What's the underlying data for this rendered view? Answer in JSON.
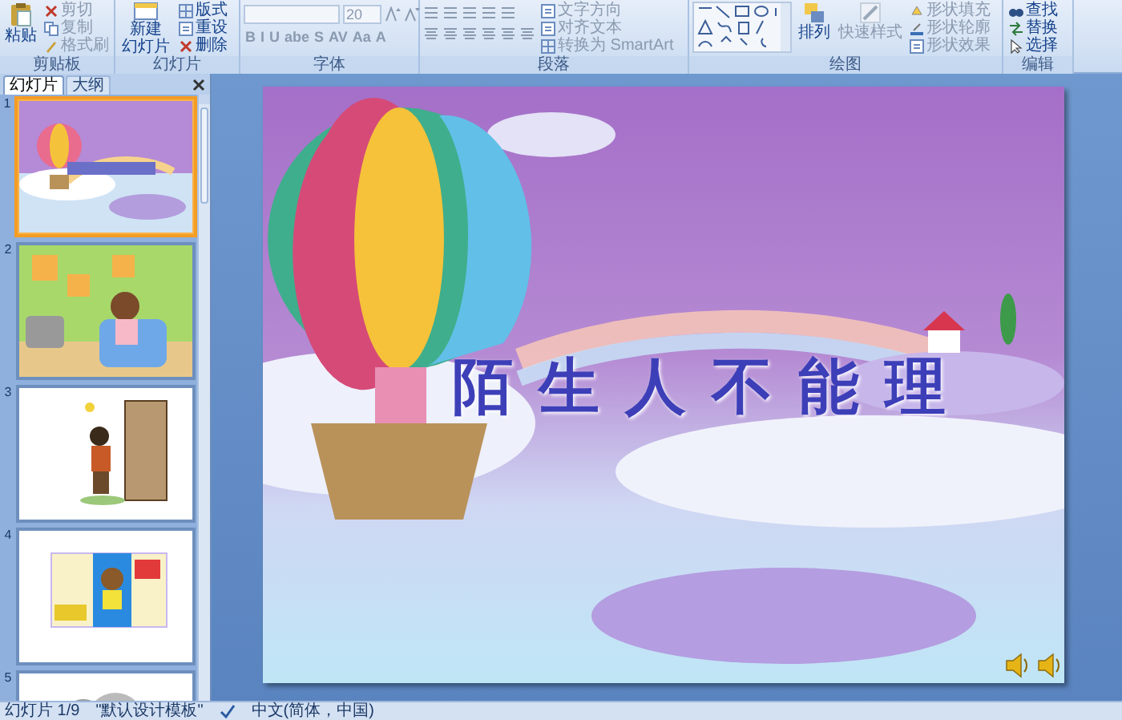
{
  "ribbon": {
    "clipboard": {
      "paste": "粘贴",
      "cut": "剪切",
      "copy": "复制",
      "format_painter": "格式刷",
      "label": "剪贴板"
    },
    "slides": {
      "new_slide": [
        "新建",
        "幻灯片"
      ],
      "layout": "版式",
      "reset": "重设",
      "delete": "删除",
      "label": "幻灯片"
    },
    "font": {
      "size": "20",
      "format_buttons": [
        "B",
        "I",
        "U",
        "abe",
        "S",
        "AV",
        "Aa",
        "A"
      ],
      "label": "字体"
    },
    "paragraph": {
      "text_direction": "文字方向",
      "align_text": "对齐文本",
      "smartart": "转换为 SmartArt",
      "label": "段落"
    },
    "drawing": {
      "arrange": "排列",
      "quick_styles": "快速样式",
      "shape_fill": "形状填充",
      "shape_outline": "形状轮廓",
      "shape_effects": "形状效果",
      "label": "绘图"
    },
    "editing": {
      "find": "查找",
      "replace": "替换",
      "select": "选择",
      "label": "编辑"
    }
  },
  "panel": {
    "tabs": [
      {
        "label": "幻灯片",
        "selected": true
      },
      {
        "label": "大纲",
        "selected": false
      }
    ],
    "thumbnails": [
      {
        "number": "1",
        "selected": true
      },
      {
        "number": "2",
        "selected": false
      },
      {
        "number": "3",
        "selected": false
      },
      {
        "number": "4",
        "selected": false
      },
      {
        "number": "5",
        "selected": false
      }
    ]
  },
  "slide": {
    "title": "陌生人不能理"
  },
  "status_bar": {
    "slide": "幻灯片 1/9",
    "theme": "\"默认设计模板\"",
    "language": "中文(简体，中国)"
  }
}
